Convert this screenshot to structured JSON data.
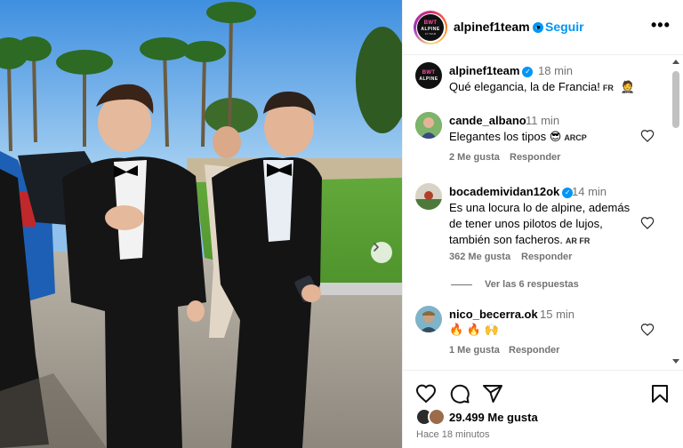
{
  "post": {
    "account": "alpinef1team",
    "follow_label": "Seguir",
    "more_label": "•••",
    "logo": {
      "line1": "BWT",
      "line2": "ALPINE",
      "line3": "F1 TEAM"
    }
  },
  "caption": {
    "user": "alpinef1team",
    "time": "18 min",
    "text": "Qué elegancia, la de Francia!",
    "tag": "FR",
    "emoji": "🤵"
  },
  "comments": [
    {
      "user": "cande_albano",
      "time": "11 min",
      "text": "Elegantes los tipos",
      "emoji": "😎",
      "tag": "ARCP",
      "likes": "2 Me gusta",
      "reply_label": "Responder"
    },
    {
      "user": "bocademividan12ok",
      "time": "14 min",
      "text": "Es una locura lo de alpine, además de tener unos pilotos de lujos, también son facheros.",
      "tag": "AR FR",
      "likes": "362 Me gusta",
      "reply_label": "Responder"
    },
    {
      "user": "nico_becerra.ok",
      "time": "15 min",
      "text": "🔥 🔥 🙌",
      "likes": "1 Me gusta",
      "reply_label": "Responder"
    }
  ],
  "view_replies": "Ver las 6 respuestas",
  "footer": {
    "likes": "29.499 Me gusta",
    "posted": "Hace 18 minutos"
  },
  "colors": {
    "accent": "#0095f6",
    "muted": "#737373",
    "border": "#efefef"
  }
}
